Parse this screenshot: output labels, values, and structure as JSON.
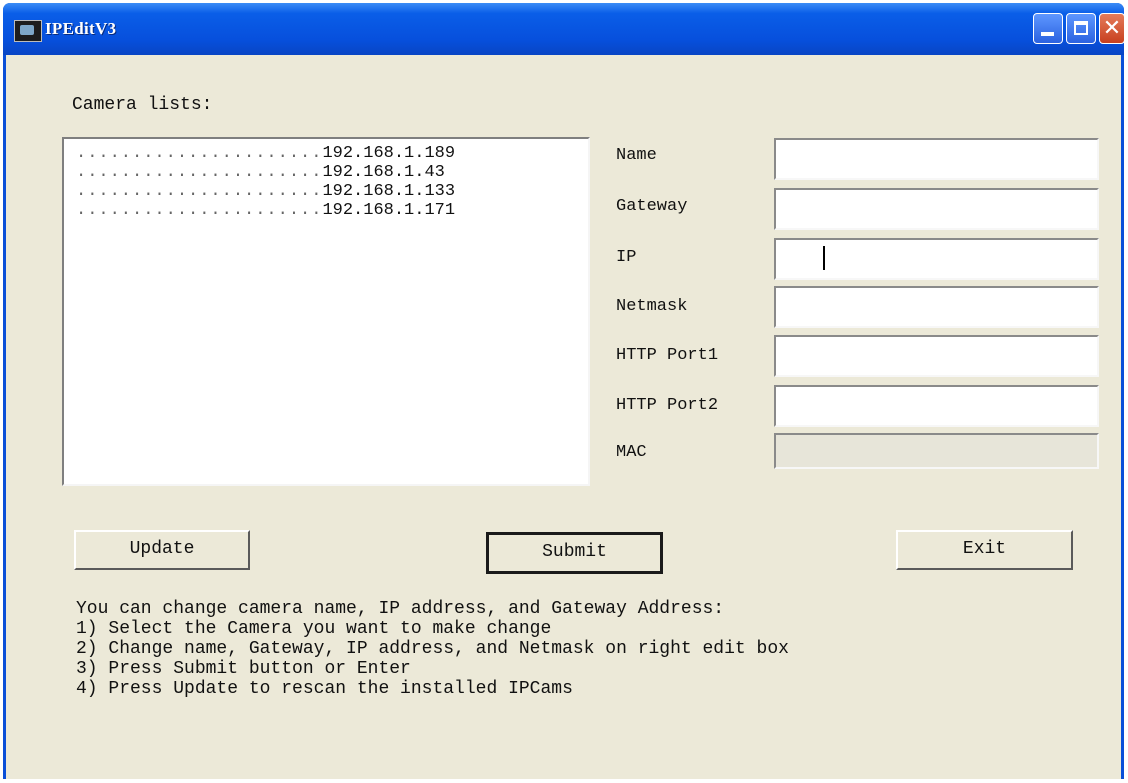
{
  "window": {
    "title": "IPEditV3"
  },
  "camera_list": {
    "label": "Camera lists:",
    "items": [
      {
        "ip": "192.168.1.189"
      },
      {
        "ip": "192.168.1.43"
      },
      {
        "ip": "192.168.1.133"
      },
      {
        "ip": "192.168.1.171"
      }
    ]
  },
  "fields": {
    "name": {
      "label": "Name",
      "value": ""
    },
    "gateway": {
      "label": "Gateway",
      "value": ""
    },
    "ip": {
      "label": "IP",
      "value": ""
    },
    "netmask": {
      "label": "Netmask",
      "value": ""
    },
    "http_port1": {
      "label": "HTTP Port1",
      "value": ""
    },
    "http_port2": {
      "label": "HTTP Port2",
      "value": ""
    },
    "mac": {
      "label": "MAC",
      "value": ""
    }
  },
  "buttons": {
    "update": "Update",
    "submit": "Submit",
    "exit": "Exit"
  },
  "instructions": [
    "You can change camera name, IP address, and Gateway Address:",
    "1) Select the Camera you want to make change",
    "2) Change name, Gateway, IP address, and Netmask on right edit box",
    "3) Press Submit button or Enter",
    "4) Press Update to rescan the installed IPCams"
  ],
  "icons": {
    "app": "camera-app-icon",
    "minimize": "minimize-icon",
    "maximize": "maximize-icon",
    "close": "close-icon"
  },
  "colors": {
    "titlebar": "#0750dd",
    "client": "#ece9d8",
    "close": "#c8401f"
  }
}
